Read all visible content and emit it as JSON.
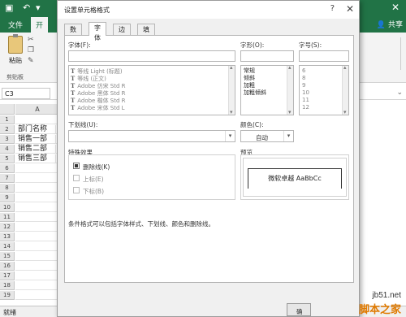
{
  "excel": {
    "ribbon_tabs": [
      "文件",
      "开"
    ],
    "share_label": "共享",
    "paste_label": "粘贴",
    "clipboard_group": "剪贴板",
    "namebox": "C3",
    "column_header": "A",
    "rows": [
      "1",
      "2",
      "3",
      "4",
      "5",
      "6",
      "7",
      "8",
      "9",
      "10",
      "11",
      "12",
      "13",
      "14",
      "15",
      "16",
      "17",
      "18",
      "19"
    ],
    "cells": [
      "部门名称",
      "销售一部",
      "销售二部",
      "销售三部"
    ],
    "status_text": "就绪"
  },
  "dialog": {
    "title": "设置单元格格式",
    "help": "?",
    "close": "✕",
    "tabs": [
      "数字",
      "字体",
      "边框",
      "填充"
    ],
    "active_tab_index": 1,
    "font_label": "字体(F):",
    "font_value": "",
    "fonts": [
      "等线 Light (标题)",
      "等线 (正文)",
      "Adobe 仿宋 Std R",
      "Adobe 黑体 Std R",
      "Adobe 楷体 Std R",
      "Adobe 宋体 Std L"
    ],
    "style_label": "字形(O):",
    "style_value": "",
    "styles": [
      "常规",
      "倾斜",
      "加粗",
      "加粗倾斜"
    ],
    "size_label": "字号(S):",
    "size_value": "",
    "sizes": [
      "6",
      "8",
      "9",
      "10",
      "11",
      "12"
    ],
    "underline_label": "下划线(U):",
    "underline_value": "",
    "color_label": "颜色(C):",
    "color_value": "自动",
    "effects_label": "特殊效果",
    "strikethrough_label": "删除线(K)",
    "strikethrough_checked": true,
    "superscript_label": "上标(E)",
    "subscript_label": "下标(B)",
    "preview_label": "预览",
    "preview_text": "微软卓越  AaBbCc",
    "note": "条件格式可以包括字体样式、下划线、颜色和删除线。",
    "bottom_button_partial": "确"
  },
  "watermark": {
    "url": "jb51.net",
    "brand": "脚本之家"
  },
  "colors": {
    "excel_green": "#217346",
    "dialog_bg": "#f0f0f0",
    "watermark_orange": "#e07a00"
  }
}
